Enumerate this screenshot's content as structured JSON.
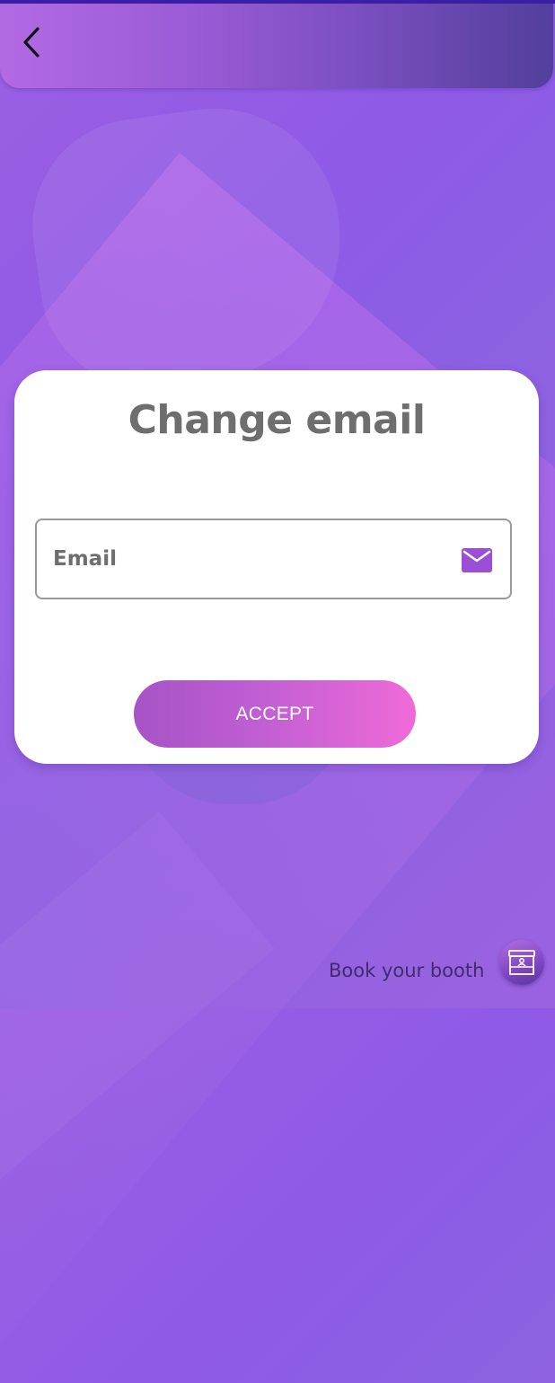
{
  "header": {
    "back_icon": "chevron-left-icon"
  },
  "card": {
    "title": "Change email",
    "email_field": {
      "placeholder": "Email",
      "value": "",
      "icon": "mail-icon"
    },
    "accept_label": "ACCEPT"
  },
  "footer": {
    "book_label": "Book your booth",
    "booth_icon": "booth-icon"
  },
  "colors": {
    "accent": "#9b4fd6",
    "button_gradient_start": "#a653c6",
    "button_gradient_end": "#f06ad8",
    "title_text": "#6e6e6e"
  }
}
